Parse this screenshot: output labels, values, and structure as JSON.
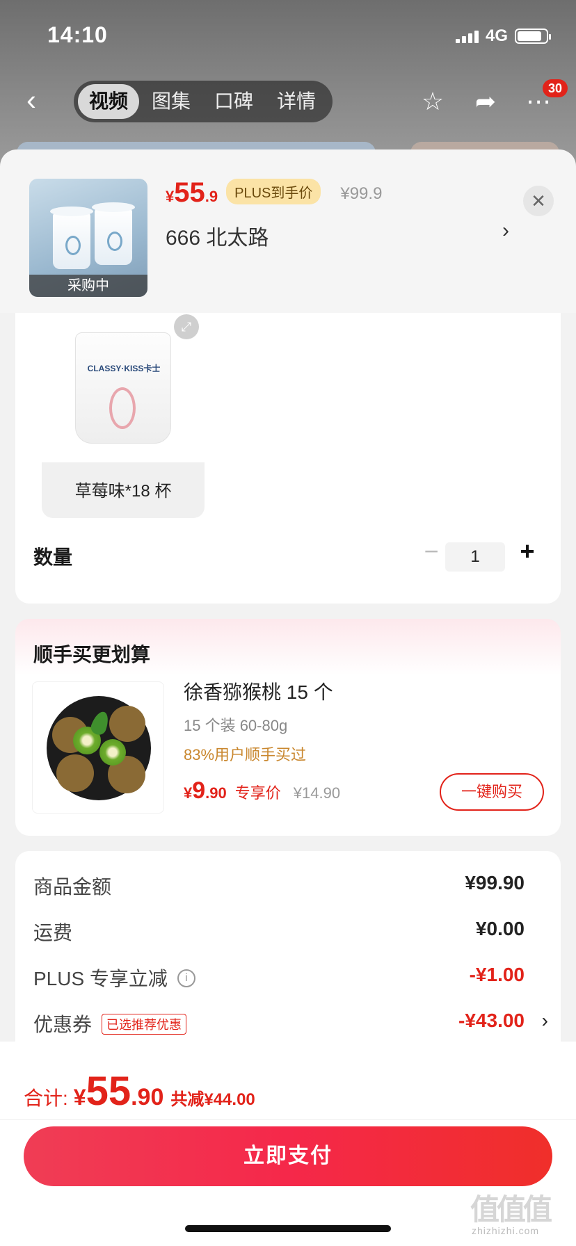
{
  "status_bar": {
    "time": "14:10",
    "network": "4G",
    "battery_level": 0.85
  },
  "nav": {
    "tabs": [
      "视频",
      "图集",
      "口碑",
      "详情"
    ],
    "active_tab_index": 0,
    "cart_badge": "30"
  },
  "product": {
    "thumb_label": "采购中",
    "price_int": "55",
    "price_dec": ".9",
    "plus_tag": "PLUS到手价",
    "original_price": "¥99.9",
    "address": "666  北太路"
  },
  "spec": {
    "variant_name": "草莓味*18 杯",
    "variant_brand": "CLASSY·KISS卡士",
    "quantity_label": "数量",
    "quantity": "1"
  },
  "addon": {
    "title": "顺手买更划算",
    "name": "徐香猕猴桃 15 个",
    "spec": "15 个装  60-80g",
    "rate": "83%用户顺手买过",
    "price_int": "9",
    "price_dec": ".90",
    "price_tag": "专享价",
    "original_price": "¥14.90",
    "buy_label": "一键购买"
  },
  "summary": {
    "rows": [
      {
        "label": "商品金额",
        "value": "¥99.90"
      },
      {
        "label": "运费",
        "value": "¥0.00"
      },
      {
        "label": "PLUS 专享立减",
        "value": "-¥1.00"
      },
      {
        "label": "优惠券",
        "value": "-¥43.00",
        "tag": "已选推荐优惠"
      }
    ]
  },
  "footer": {
    "total_label": "合计:",
    "total_int": "55",
    "total_dec": ".90",
    "saved": "共减¥44.00",
    "pay_label": "立即支付",
    "watermark": "值值值",
    "watermark_url": "zhizhizhi.com"
  },
  "colors": {
    "accent_red": "#e2231a",
    "plus_gold": "#fbe3a6",
    "rate_orange": "#c9872e"
  }
}
